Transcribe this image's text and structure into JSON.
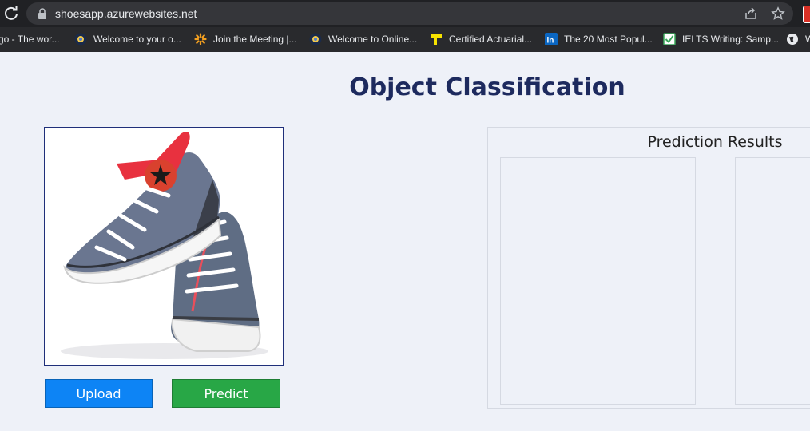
{
  "browser": {
    "url": "shoesapp.azurewebsites.net",
    "bookmarks": [
      {
        "label": "go - The wor...",
        "icon": "page-icon"
      },
      {
        "label": "Welcome to your o...",
        "icon": "chrome-icon"
      },
      {
        "label": "Join the Meeting |...",
        "icon": "sparkle-icon"
      },
      {
        "label": "Welcome to Online...",
        "icon": "chrome-icon"
      },
      {
        "label": "Certified Actuarial...",
        "icon": "flag-icon"
      },
      {
        "label": "The 20 Most Popul...",
        "icon": "linkedin-icon"
      },
      {
        "label": "IELTS Writing: Samp...",
        "icon": "check-icon"
      },
      {
        "label": "W",
        "icon": "globe-icon"
      }
    ]
  },
  "page": {
    "title": "Object Classification",
    "upload_label": "Upload",
    "predict_label": "Predict",
    "results_title": "Prediction Results"
  },
  "colors": {
    "title": "#1d2a5e",
    "upload": "#0d84f5",
    "predict": "#28a746",
    "background": "#eef1f8"
  }
}
